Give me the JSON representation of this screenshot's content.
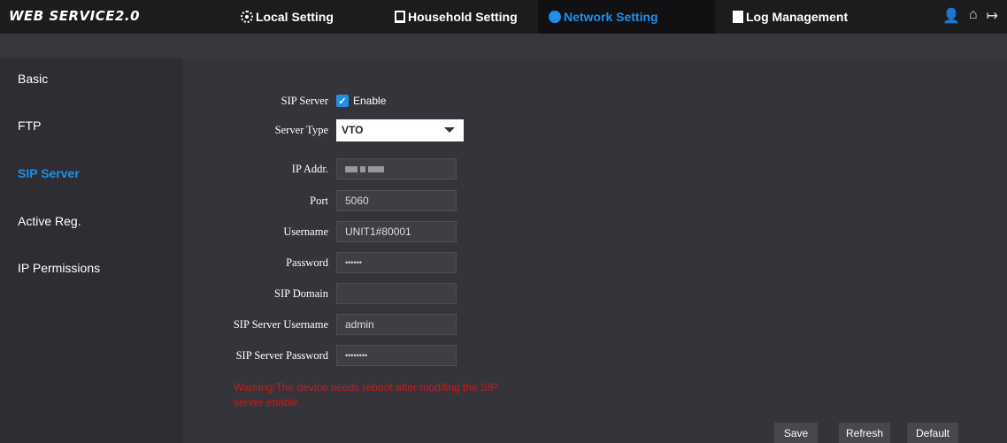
{
  "app": {
    "title": "WEB SERVICE2.0"
  },
  "nav": {
    "local": "Local Setting",
    "household": "Household Setting",
    "network": "Network Setting",
    "log": "Log Management"
  },
  "toolbar_icons": [
    "user-icon",
    "home-icon",
    "logout-icon"
  ],
  "sidebar": {
    "items": [
      {
        "label": "Basic"
      },
      {
        "label": "FTP"
      },
      {
        "label": "SIP Server",
        "active": true
      },
      {
        "label": "Active Reg."
      },
      {
        "label": "IP Permissions"
      }
    ]
  },
  "form": {
    "sip_server": {
      "label": "SIP Server",
      "checked": true,
      "checkbox_label": "Enable"
    },
    "server_type": {
      "label": "Server Type",
      "value": "VTO"
    },
    "ip_addr": {
      "label": "IP Addr."
    },
    "port": {
      "label": "Port",
      "value": "5060"
    },
    "username": {
      "label": "Username",
      "value": "UNIT1#80001"
    },
    "password": {
      "label": "Password",
      "value": "••••••"
    },
    "sip_domain": {
      "label": "SIP Domain",
      "value": ""
    },
    "sip_server_username": {
      "label": "SIP Server Username",
      "value": "admin"
    },
    "sip_server_password": {
      "label": "SIP Server Password",
      "value": "••••••••"
    }
  },
  "warning": "Warning:The device needs reboot after modifing the SIP server enable.",
  "buttons": {
    "save": "Save",
    "refresh": "Refresh",
    "default": "Default"
  },
  "colors": {
    "accent": "#1e90e8",
    "warning": "#d01818",
    "background": "#2a2a2e"
  }
}
